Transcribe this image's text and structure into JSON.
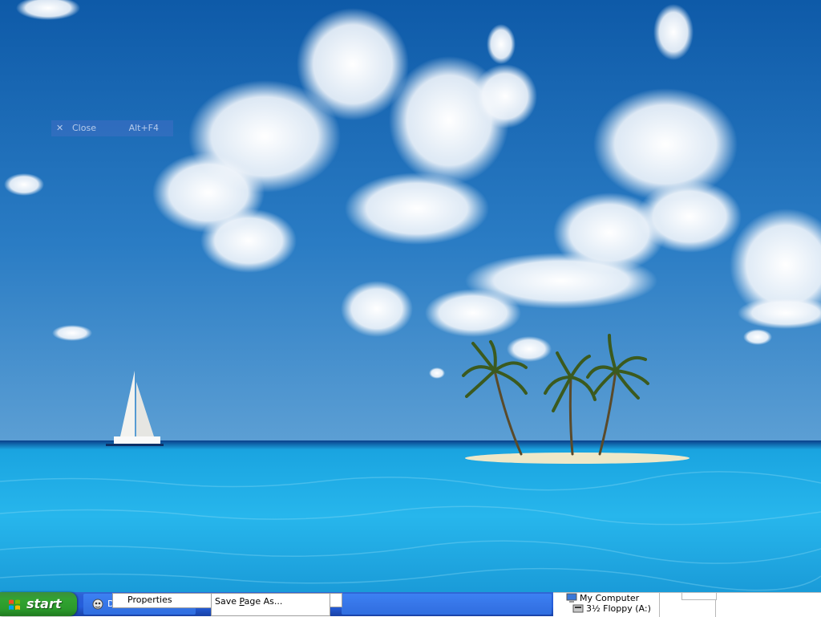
{
  "desktop": {
    "wallpaper": "tropical-island-palms-sailboat",
    "close_menu_item": {
      "icon": "close-icon",
      "label": "Close",
      "accelerator": "Alt+F4"
    }
  },
  "taskbar": {
    "start_label": "start",
    "task_button_1_label": "D",
    "colors": {
      "taskbar": "#245edc",
      "start": "#31a331"
    }
  },
  "menus": {
    "properties_label": "Properties",
    "save_page_pre": "Save ",
    "save_page_key": "P",
    "save_page_post": "age As..."
  },
  "explorer": {
    "my_computer_label": "My Computer",
    "floppy_label": "3½ Floppy (A:)"
  }
}
